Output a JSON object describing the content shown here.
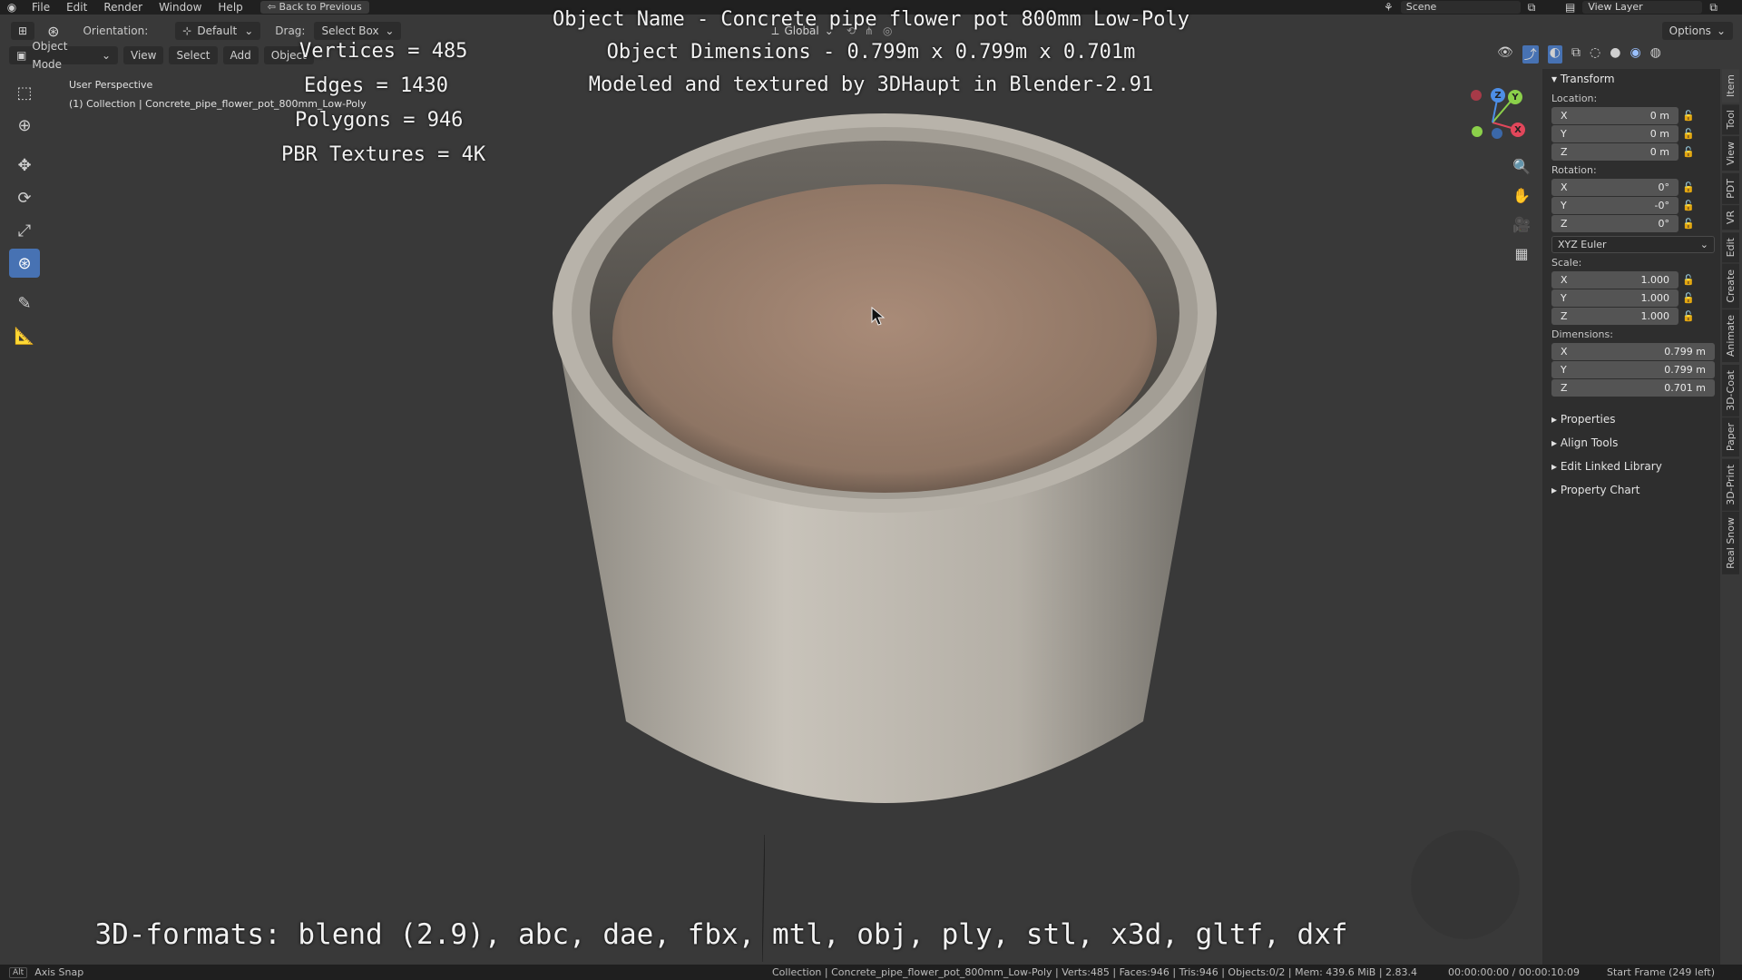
{
  "menubar": {
    "items": [
      "File",
      "Edit",
      "Render",
      "Window",
      "Help"
    ],
    "back_button": "Back to Previous",
    "scene": "Scene",
    "view_layer": "View Layer"
  },
  "header": {
    "orientation_label": "Orientation:",
    "orientation_value": "Default",
    "drag_label": "Drag:",
    "drag_value": "Select Box",
    "transform_orientation": "Global",
    "options": "Options"
  },
  "mode_menu": {
    "mode": "Object Mode",
    "items": [
      "View",
      "Select",
      "Add",
      "Object"
    ]
  },
  "viewport": {
    "perspective": "User Perspective",
    "collection": "(1) Collection | Concrete_pipe_flower_pot_800mm_Low-Poly",
    "stats": {
      "vertices": "Vertices = 485",
      "edges": "Edges = 1430",
      "polygons": "Polygons = 946",
      "textures": "PBR Textures = 4K"
    },
    "overlay": {
      "name": "Object Name - Concrete pipe flower pot 800mm Low-Poly",
      "dims": "Object Dimensions -  0.799m x 0.799m x 0.701m",
      "credit": "Modeled and textured by 3DHaupt in Blender-2.91"
    },
    "formats": "3D-formats: blend (2.9), abc, dae, fbx, mtl, obj, ply, stl, x3d, gltf, dxf",
    "gizmo": {
      "x": "X",
      "y": "Y",
      "z": "Z"
    }
  },
  "npanel": {
    "transform": "Transform",
    "location_label": "Location:",
    "location": [
      {
        "axis": "X",
        "value": "0 m"
      },
      {
        "axis": "Y",
        "value": "0 m"
      },
      {
        "axis": "Z",
        "value": "0 m"
      }
    ],
    "rotation_label": "Rotation:",
    "rotation": [
      {
        "axis": "X",
        "value": "0°"
      },
      {
        "axis": "Y",
        "value": "-0°"
      },
      {
        "axis": "Z",
        "value": "0°"
      }
    ],
    "rotation_mode": "XYZ Euler",
    "scale_label": "Scale:",
    "scale": [
      {
        "axis": "X",
        "value": "1.000"
      },
      {
        "axis": "Y",
        "value": "1.000"
      },
      {
        "axis": "Z",
        "value": "1.000"
      }
    ],
    "dimensions_label": "Dimensions:",
    "dimensions": [
      {
        "axis": "X",
        "value": "0.799 m"
      },
      {
        "axis": "Y",
        "value": "0.799 m"
      },
      {
        "axis": "Z",
        "value": "0.701 m"
      }
    ],
    "collapsed": [
      "Properties",
      "Align Tools",
      "Edit Linked Library",
      "Property Chart"
    ]
  },
  "vtabs": [
    "Item",
    "Tool",
    "View",
    "PDT",
    "VR",
    "Edit",
    "Create",
    "Animate",
    "3D-Coat",
    "Paper",
    "3D-Print",
    "Real Snow"
  ],
  "statusbar": {
    "left": "Axis Snap",
    "key": "Alt",
    "info": "Collection | Concrete_pipe_flower_pot_800mm_Low-Poly | Verts:485 | Faces:946 | Tris:946 | Objects:0/2 | Mem: 439.6 MiB | 2.83.4",
    "time": "00:00:00:00 / 00:00:10:09",
    "frame": "Start Frame (249 left)"
  },
  "colors": {
    "accent": "#4772b3",
    "axis_x": "#e2475b",
    "axis_y": "#8bd04a",
    "axis_z": "#4d8ee6"
  }
}
